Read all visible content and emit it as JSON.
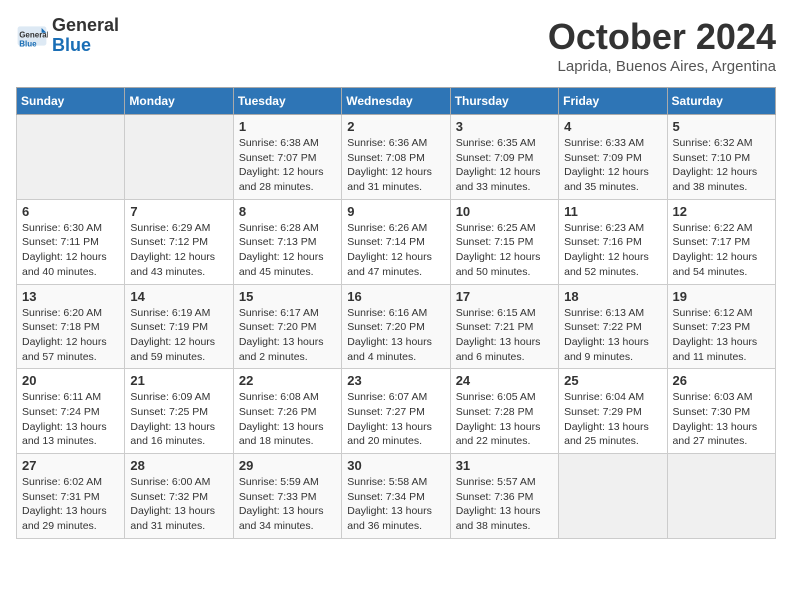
{
  "header": {
    "logo": {
      "general": "General",
      "blue": "Blue"
    },
    "title": "October 2024",
    "location": "Laprida, Buenos Aires, Argentina"
  },
  "calendar": {
    "weekdays": [
      "Sunday",
      "Monday",
      "Tuesday",
      "Wednesday",
      "Thursday",
      "Friday",
      "Saturday"
    ],
    "weeks": [
      [
        {
          "day": "",
          "empty": true
        },
        {
          "day": "",
          "empty": true
        },
        {
          "day": "1",
          "sunrise": "6:38 AM",
          "sunset": "7:07 PM",
          "daylight": "12 hours and 28 minutes."
        },
        {
          "day": "2",
          "sunrise": "6:36 AM",
          "sunset": "7:08 PM",
          "daylight": "12 hours and 31 minutes."
        },
        {
          "day": "3",
          "sunrise": "6:35 AM",
          "sunset": "7:09 PM",
          "daylight": "12 hours and 33 minutes."
        },
        {
          "day": "4",
          "sunrise": "6:33 AM",
          "sunset": "7:09 PM",
          "daylight": "12 hours and 35 minutes."
        },
        {
          "day": "5",
          "sunrise": "6:32 AM",
          "sunset": "7:10 PM",
          "daylight": "12 hours and 38 minutes."
        }
      ],
      [
        {
          "day": "6",
          "sunrise": "6:30 AM",
          "sunset": "7:11 PM",
          "daylight": "12 hours and 40 minutes."
        },
        {
          "day": "7",
          "sunrise": "6:29 AM",
          "sunset": "7:12 PM",
          "daylight": "12 hours and 43 minutes."
        },
        {
          "day": "8",
          "sunrise": "6:28 AM",
          "sunset": "7:13 PM",
          "daylight": "12 hours and 45 minutes."
        },
        {
          "day": "9",
          "sunrise": "6:26 AM",
          "sunset": "7:14 PM",
          "daylight": "12 hours and 47 minutes."
        },
        {
          "day": "10",
          "sunrise": "6:25 AM",
          "sunset": "7:15 PM",
          "daylight": "12 hours and 50 minutes."
        },
        {
          "day": "11",
          "sunrise": "6:23 AM",
          "sunset": "7:16 PM",
          "daylight": "12 hours and 52 minutes."
        },
        {
          "day": "12",
          "sunrise": "6:22 AM",
          "sunset": "7:17 PM",
          "daylight": "12 hours and 54 minutes."
        }
      ],
      [
        {
          "day": "13",
          "sunrise": "6:20 AM",
          "sunset": "7:18 PM",
          "daylight": "12 hours and 57 minutes."
        },
        {
          "day": "14",
          "sunrise": "6:19 AM",
          "sunset": "7:19 PM",
          "daylight": "12 hours and 59 minutes."
        },
        {
          "day": "15",
          "sunrise": "6:17 AM",
          "sunset": "7:20 PM",
          "daylight": "13 hours and 2 minutes."
        },
        {
          "day": "16",
          "sunrise": "6:16 AM",
          "sunset": "7:20 PM",
          "daylight": "13 hours and 4 minutes."
        },
        {
          "day": "17",
          "sunrise": "6:15 AM",
          "sunset": "7:21 PM",
          "daylight": "13 hours and 6 minutes."
        },
        {
          "day": "18",
          "sunrise": "6:13 AM",
          "sunset": "7:22 PM",
          "daylight": "13 hours and 9 minutes."
        },
        {
          "day": "19",
          "sunrise": "6:12 AM",
          "sunset": "7:23 PM",
          "daylight": "13 hours and 11 minutes."
        }
      ],
      [
        {
          "day": "20",
          "sunrise": "6:11 AM",
          "sunset": "7:24 PM",
          "daylight": "13 hours and 13 minutes."
        },
        {
          "day": "21",
          "sunrise": "6:09 AM",
          "sunset": "7:25 PM",
          "daylight": "13 hours and 16 minutes."
        },
        {
          "day": "22",
          "sunrise": "6:08 AM",
          "sunset": "7:26 PM",
          "daylight": "13 hours and 18 minutes."
        },
        {
          "day": "23",
          "sunrise": "6:07 AM",
          "sunset": "7:27 PM",
          "daylight": "13 hours and 20 minutes."
        },
        {
          "day": "24",
          "sunrise": "6:05 AM",
          "sunset": "7:28 PM",
          "daylight": "13 hours and 22 minutes."
        },
        {
          "day": "25",
          "sunrise": "6:04 AM",
          "sunset": "7:29 PM",
          "daylight": "13 hours and 25 minutes."
        },
        {
          "day": "26",
          "sunrise": "6:03 AM",
          "sunset": "7:30 PM",
          "daylight": "13 hours and 27 minutes."
        }
      ],
      [
        {
          "day": "27",
          "sunrise": "6:02 AM",
          "sunset": "7:31 PM",
          "daylight": "13 hours and 29 minutes."
        },
        {
          "day": "28",
          "sunrise": "6:00 AM",
          "sunset": "7:32 PM",
          "daylight": "13 hours and 31 minutes."
        },
        {
          "day": "29",
          "sunrise": "5:59 AM",
          "sunset": "7:33 PM",
          "daylight": "13 hours and 34 minutes."
        },
        {
          "day": "30",
          "sunrise": "5:58 AM",
          "sunset": "7:34 PM",
          "daylight": "13 hours and 36 minutes."
        },
        {
          "day": "31",
          "sunrise": "5:57 AM",
          "sunset": "7:36 PM",
          "daylight": "13 hours and 38 minutes."
        },
        {
          "day": "",
          "empty": true
        },
        {
          "day": "",
          "empty": true
        }
      ]
    ]
  }
}
